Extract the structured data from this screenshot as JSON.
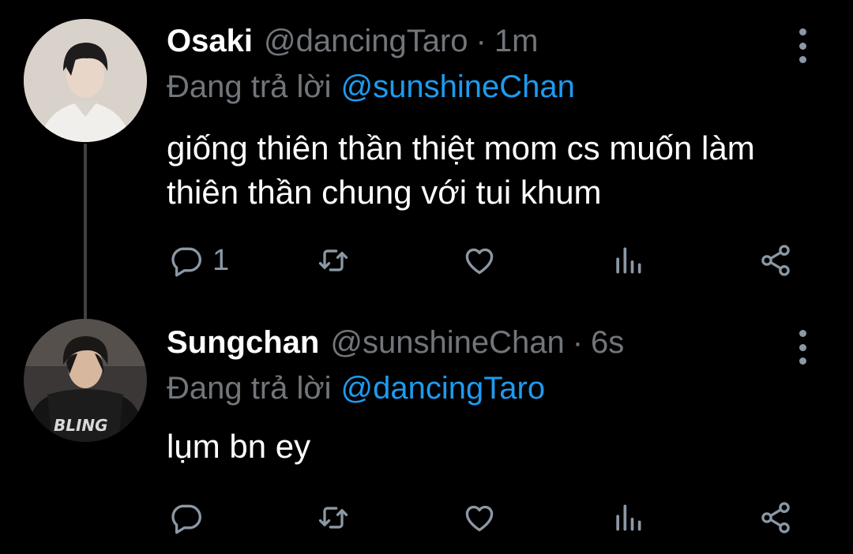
{
  "colors": {
    "background": "#000000",
    "text": "#ffffff",
    "muted": "#71767b",
    "mention": "#1d9bf0",
    "icon": "#8b98a5",
    "thread_line": "#3e4144"
  },
  "tweets": [
    {
      "display_name": "Osaki",
      "handle": "@dancingTaro",
      "separator": "·",
      "time": "1m",
      "reply_prefix": "Đang trả lời",
      "reply_to": "@sunshineChan",
      "body": "giống thiên thần thiệt mom cs muốn làm thiên thần chung với tui khum",
      "reply_count": "1",
      "icons": [
        "reply-icon",
        "retweet-icon",
        "like-icon",
        "analytics-icon",
        "share-icon",
        "more-icon"
      ]
    },
    {
      "display_name": "Sungchan",
      "handle": "@sunshineChan",
      "separator": "·",
      "time": "6s",
      "reply_prefix": "Đang trả lời",
      "reply_to": "@dancingTaro",
      "body": "lụm bn ey",
      "reply_count": "",
      "icons": [
        "reply-icon",
        "retweet-icon",
        "like-icon",
        "analytics-icon",
        "share-icon",
        "more-icon"
      ]
    }
  ]
}
